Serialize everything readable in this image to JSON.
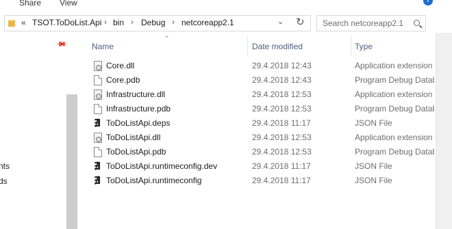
{
  "ribbon": {
    "tabs": [
      "Share",
      "View"
    ]
  },
  "address": {
    "overflow": "«",
    "crumbs": [
      "TSOT.ToDoList.Api",
      "bin",
      "Debug",
      "netcoreapp2.1"
    ],
    "separator": "›"
  },
  "search": {
    "placeholder": "Search netcoreapp2.1"
  },
  "nav": {
    "items": [
      "nts",
      "ds"
    ]
  },
  "columns": {
    "name": "Name",
    "date": "Date modified",
    "type": "Type"
  },
  "files": [
    {
      "name": "Core.dll",
      "date": "29.4.2018 12:43",
      "type": "Application extension",
      "icon": "dll-file-icon"
    },
    {
      "name": "Core.pdb",
      "date": "29.4.2018 12:43",
      "type": "Program Debug Database",
      "icon": "generic-file-icon"
    },
    {
      "name": "Infrastructure.dll",
      "date": "29.4.2018 12:53",
      "type": "Application extension",
      "icon": "dll-file-icon"
    },
    {
      "name": "Infrastructure.pdb",
      "date": "29.4.2018 12:53",
      "type": "Program Debug Database",
      "icon": "generic-file-icon"
    },
    {
      "name": "ToDoListApi.deps",
      "date": "29.4.2018 11:17",
      "type": "JSON File",
      "icon": "json-file-icon"
    },
    {
      "name": "ToDoListApi.dll",
      "date": "29.4.2018 12:53",
      "type": "Application extension",
      "icon": "dll-file-icon"
    },
    {
      "name": "ToDoListApi.pdb",
      "date": "29.4.2018 12:53",
      "type": "Program Debug Database",
      "icon": "generic-file-icon"
    },
    {
      "name": "ToDoListApi.runtimeconfig.dev",
      "date": "29.4.2018 11:17",
      "type": "JSON File",
      "icon": "json-file-icon"
    },
    {
      "name": "ToDoListApi.runtimeconfig",
      "date": "29.4.2018 11:17",
      "type": "JSON File",
      "icon": "json-file-icon"
    }
  ]
}
